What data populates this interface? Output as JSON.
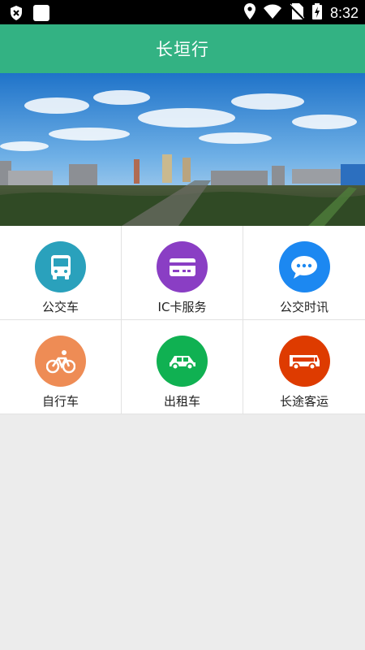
{
  "status_bar": {
    "time": "8:32",
    "icons": [
      "shield-x-icon",
      "square-app-icon",
      "location-icon",
      "wifi-icon",
      "no-sim-icon",
      "battery-charging-icon"
    ]
  },
  "header": {
    "title": "长垣行"
  },
  "banner": {
    "image": "city-skyline-photo"
  },
  "menu": {
    "items": [
      {
        "label": "公交车",
        "icon": "bus-icon",
        "color": "#2aa1bc"
      },
      {
        "label": "IC卡服务",
        "icon": "card-icon",
        "color": "#8a3ec4"
      },
      {
        "label": "公交时讯",
        "icon": "chat-bubble-icon",
        "color": "#1c88f1"
      },
      {
        "label": "自行车",
        "icon": "bicycle-icon",
        "color": "#ee8c55"
      },
      {
        "label": "出租车",
        "icon": "taxi-icon",
        "color": "#10b152"
      },
      {
        "label": "长途客运",
        "icon": "coach-icon",
        "color": "#de3b00"
      }
    ]
  }
}
